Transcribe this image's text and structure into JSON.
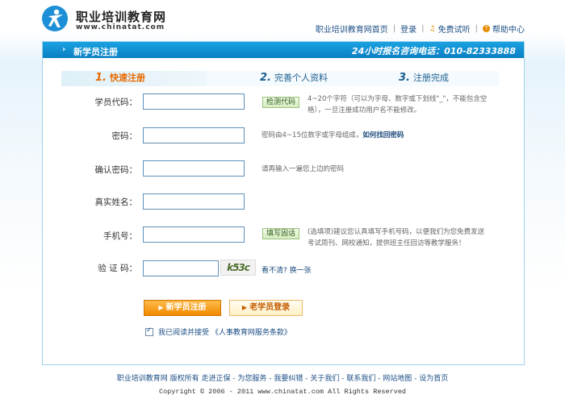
{
  "brand": {
    "name": "职业培训教育网",
    "domain": "www.chinatat.com"
  },
  "topnav": {
    "home": "职业培训教育网首页",
    "login": "登录",
    "trial": "免费试听",
    "help": "帮助中心"
  },
  "panel": {
    "title": "新学员注册",
    "hotline": "24小时报名咨询电话：010-82333888"
  },
  "steps": [
    {
      "num": "1.",
      "label": "快速注册"
    },
    {
      "num": "2.",
      "label": "完善个人资料"
    },
    {
      "num": "3.",
      "label": "注册完成"
    }
  ],
  "form": {
    "student_id": {
      "label": "学员代码：",
      "value": "",
      "check_button": "检测代码",
      "hint": "4~20个字符（可以为字母、数字或下划线\"_\"，不能包含空格），一旦注册成功用户名不能修改。"
    },
    "password": {
      "label": "密码：",
      "value": "",
      "hint": "密码由4~15位数字或字母组成，",
      "hint_link": "如何找回密码"
    },
    "confirm_password": {
      "label": "确认密码：",
      "value": "",
      "hint": "请再输入一遍您上边的密码"
    },
    "real_name": {
      "label": "真实姓名：",
      "value": ""
    },
    "phone": {
      "label": "手机号：",
      "value": "",
      "fill_button": "填写固话",
      "hint": "(选填项)建议您认真填写手机号码，以便我们为您免费发送考试周刊、网校通知，提供班主任回访等教学服务！"
    },
    "captcha": {
      "label": "验 证 码：",
      "value": "",
      "image_text": "k53c",
      "refresh": "看不清? 换一张"
    }
  },
  "buttons": {
    "new_student": "新学员注册",
    "old_student": "老学员登录"
  },
  "agreement": {
    "checked": true,
    "text": "我已阅读并接受 《人事教育网服务条款》"
  },
  "footer": {
    "links": "职业培训教育网 版权所有 走进正保 - 为您服务 - 我要纠错 - 关于我们 - 联系我们 - 网站地图 - 设为首页",
    "copyright": "Copyright © 2006 - 2011 www.chinatat.com All Rights Reserved"
  },
  "colors": {
    "accent": "#0b7fc4",
    "orange": "#f08a00"
  }
}
